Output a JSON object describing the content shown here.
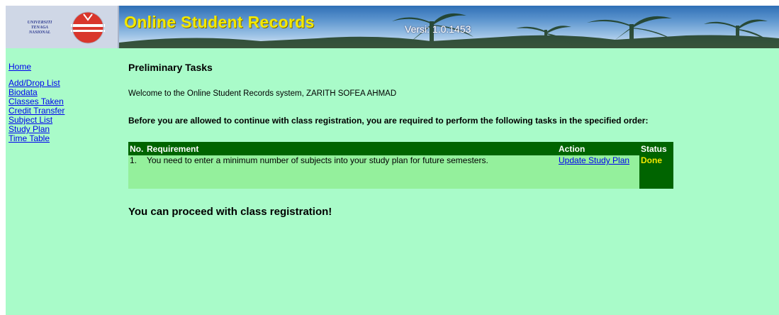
{
  "header": {
    "logo_lines": [
      "UNIVERSITI",
      "TENAGA",
      "NASIONAL"
    ],
    "title": "Online Student Records",
    "version": "Versi: 1.0.1453"
  },
  "nav": {
    "home": "Home",
    "items": [
      "Add/Drop List",
      "Biodata",
      "Classes Taken",
      "Credit Transfer",
      "Subject List",
      "Study Plan",
      "Time Table"
    ]
  },
  "main": {
    "title": "Preliminary Tasks",
    "welcome": "Welcome to the Online Student Records system, ZARITH SOFEA AHMAD",
    "instruction": "Before you are allowed to continue with class registration, you are required to perform the following tasks in the specified order:",
    "table": {
      "headers": {
        "no": "No.",
        "requirement": "Requirement",
        "action": "Action",
        "status": "Status"
      },
      "rows": [
        {
          "no": "1.",
          "requirement": "You need to enter a minimum number of subjects into your study plan for future semesters.",
          "action": "Update Study Plan",
          "status": "Done"
        }
      ]
    },
    "proceed": "You can proceed with class registration!"
  },
  "colors": {
    "page_background": "#a9fbc9",
    "table_header": "#006400",
    "table_row": "#94f09c",
    "title_yellow": "#f3e800",
    "link_blue": "#0000ee"
  }
}
